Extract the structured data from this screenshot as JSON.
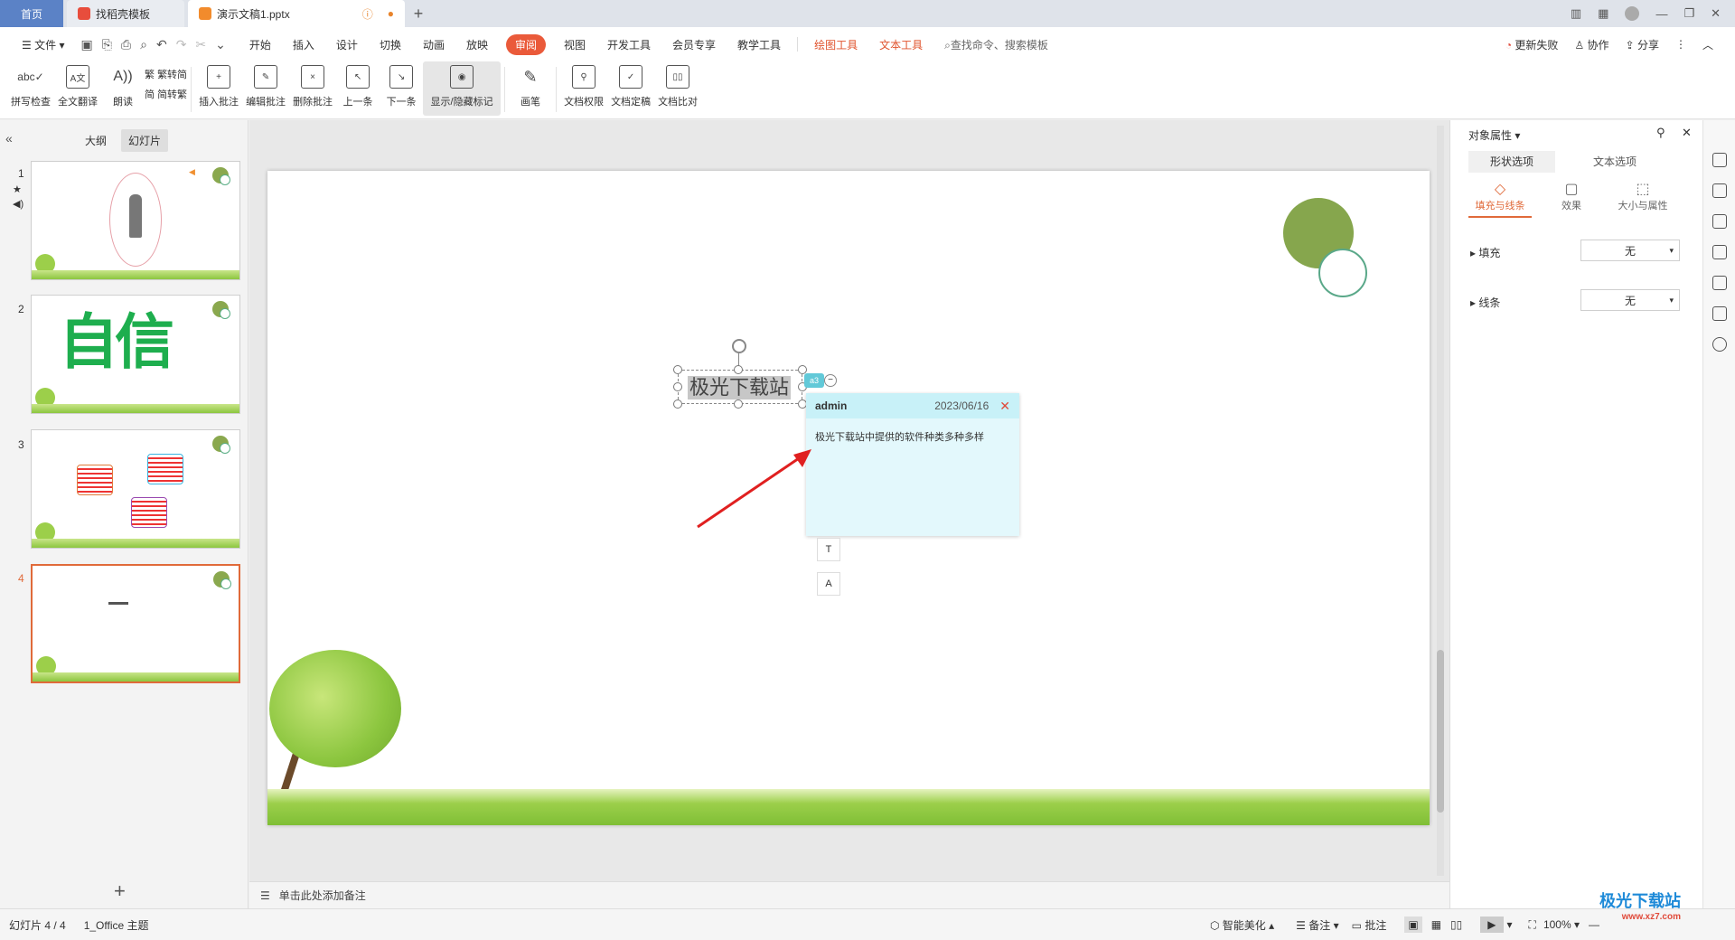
{
  "titlebar": {
    "tabs": [
      {
        "label": "首页"
      },
      {
        "label": "找稻壳模板"
      },
      {
        "label": "演示文稿1.pptx"
      }
    ],
    "new_tab": "+"
  },
  "menubar": {
    "file": "文件",
    "items": [
      "开始",
      "插入",
      "设计",
      "切换",
      "动画",
      "放映",
      "审阅",
      "视图",
      "开发工具",
      "会员专享",
      "教学工具"
    ],
    "selected": "审阅",
    "context_items": [
      "绘图工具",
      "文本工具"
    ],
    "search_placeholder": "查找命令、搜索模板",
    "right": {
      "update": "更新失败",
      "collab": "协作",
      "share": "分享"
    }
  },
  "ribbon": {
    "spell": "拼写检查",
    "translate": "全文翻译",
    "read": "朗读",
    "trad_to_simp": "繁转简",
    "simp_to_trad": "简转繁",
    "insert_comment": "插入批注",
    "edit_comment": "编辑批注",
    "delete_comment": "删除批注",
    "prev": "上一条",
    "next": "下一条",
    "show_hide": "显示/隐藏标记",
    "pen": "画笔",
    "permission": "文档权限",
    "finalize": "文档定稿",
    "compare": "文档比对"
  },
  "leftpanel": {
    "tab_outline": "大纲",
    "tab_slides": "幻灯片",
    "slides": [
      {
        "num": "1"
      },
      {
        "num": "2",
        "text": "自信"
      },
      {
        "num": "3"
      },
      {
        "num": "4"
      }
    ],
    "add": "+"
  },
  "slide": {
    "textbox": "极光下载站",
    "comment_badge": "a3"
  },
  "comment": {
    "author": "admin",
    "date": "2023/06/16",
    "text": "极光下载站中提供的软件种类多种多样"
  },
  "notes": {
    "placeholder": "单击此处添加备注"
  },
  "rightpanel": {
    "title": "对象属性",
    "tab_shape": "形状选项",
    "tab_text": "文本选项",
    "sub_fill": "填充与线条",
    "sub_effect": "效果",
    "sub_size": "大小与属性",
    "fill_label": "填充",
    "fill_value": "无",
    "line_label": "线条",
    "line_value": "无"
  },
  "statusbar": {
    "slide_info": "幻灯片 4 / 4",
    "theme": "1_Office 主题",
    "beautify": "智能美化",
    "notes": "备注",
    "comments": "批注",
    "zoom": "100%"
  },
  "watermark": {
    "text": "极光下载站",
    "url": "www.xz7.com"
  },
  "colors": {
    "accent": "#ea5a3a",
    "comment_bg": "#e3f8fc",
    "comment_header": "#c8f1f8",
    "tree_green": "#8cc63f",
    "circle": "#86a64d"
  }
}
